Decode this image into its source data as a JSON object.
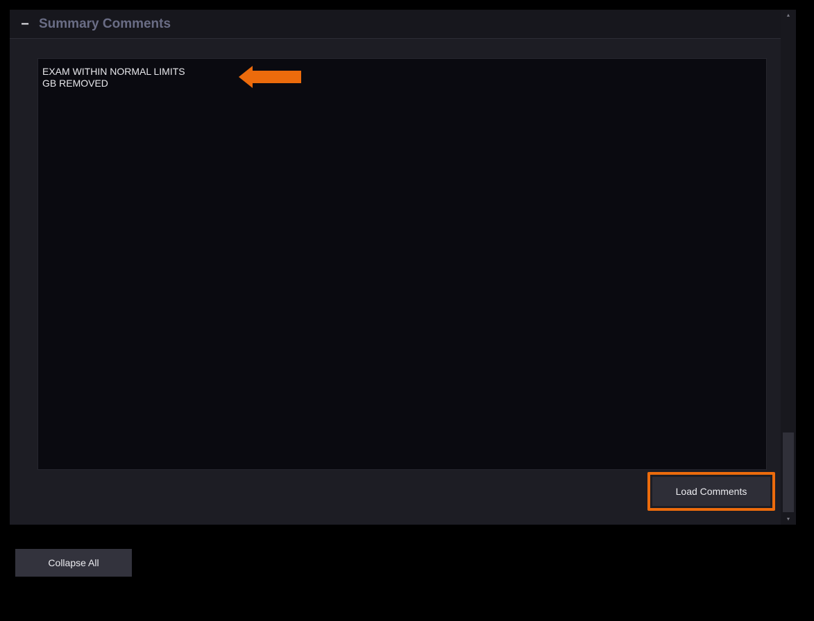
{
  "section": {
    "toggle_symbol": "−",
    "title": "Summary Comments"
  },
  "comments": {
    "lines": [
      "EXAM WITHIN NORMAL LIMITS",
      "GB REMOVED"
    ]
  },
  "buttons": {
    "load_comments": "Load Comments",
    "collapse_all": "Collapse All"
  },
  "scrollbar": {
    "up_icon": "▲",
    "down_icon": "▼"
  },
  "icons": {
    "collapse": "minus-icon",
    "annotation": "left-arrow-icon",
    "scroll_up": "triangle-up-icon",
    "scroll_down": "triangle-down-icon"
  },
  "colors": {
    "annotation_orange": "#ec6b0c",
    "panel_background": "#1d1d24",
    "text_area_background": "#0a0a10",
    "title_text": "#6a6d85"
  }
}
